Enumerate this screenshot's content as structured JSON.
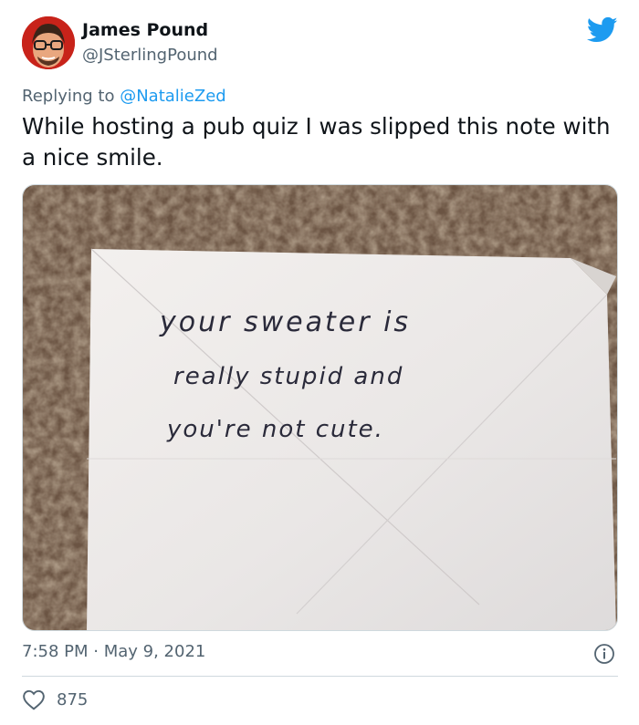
{
  "author": {
    "name": "James Pound",
    "handle": "@JSterlingPound"
  },
  "reply": {
    "prefix": "Replying to ",
    "to": "@NatalieZed"
  },
  "tweet": {
    "text": "While hosting a pub quiz I was slipped this note with a nice smile."
  },
  "note": {
    "line1": "your sweater is",
    "line2": "really stupid and",
    "line3": "you're not cute."
  },
  "meta": {
    "time": "7:58 PM",
    "separator": " · ",
    "date": "May 9, 2021"
  },
  "engagement": {
    "likes": "875"
  },
  "icons": {
    "brand": "twitter-bird-icon",
    "info": "info-icon",
    "like": "heart-icon"
  },
  "colors": {
    "accent": "#1d9bf0",
    "secondary_text": "#536471",
    "primary_text": "#0f1419",
    "border": "#cfd9de"
  }
}
